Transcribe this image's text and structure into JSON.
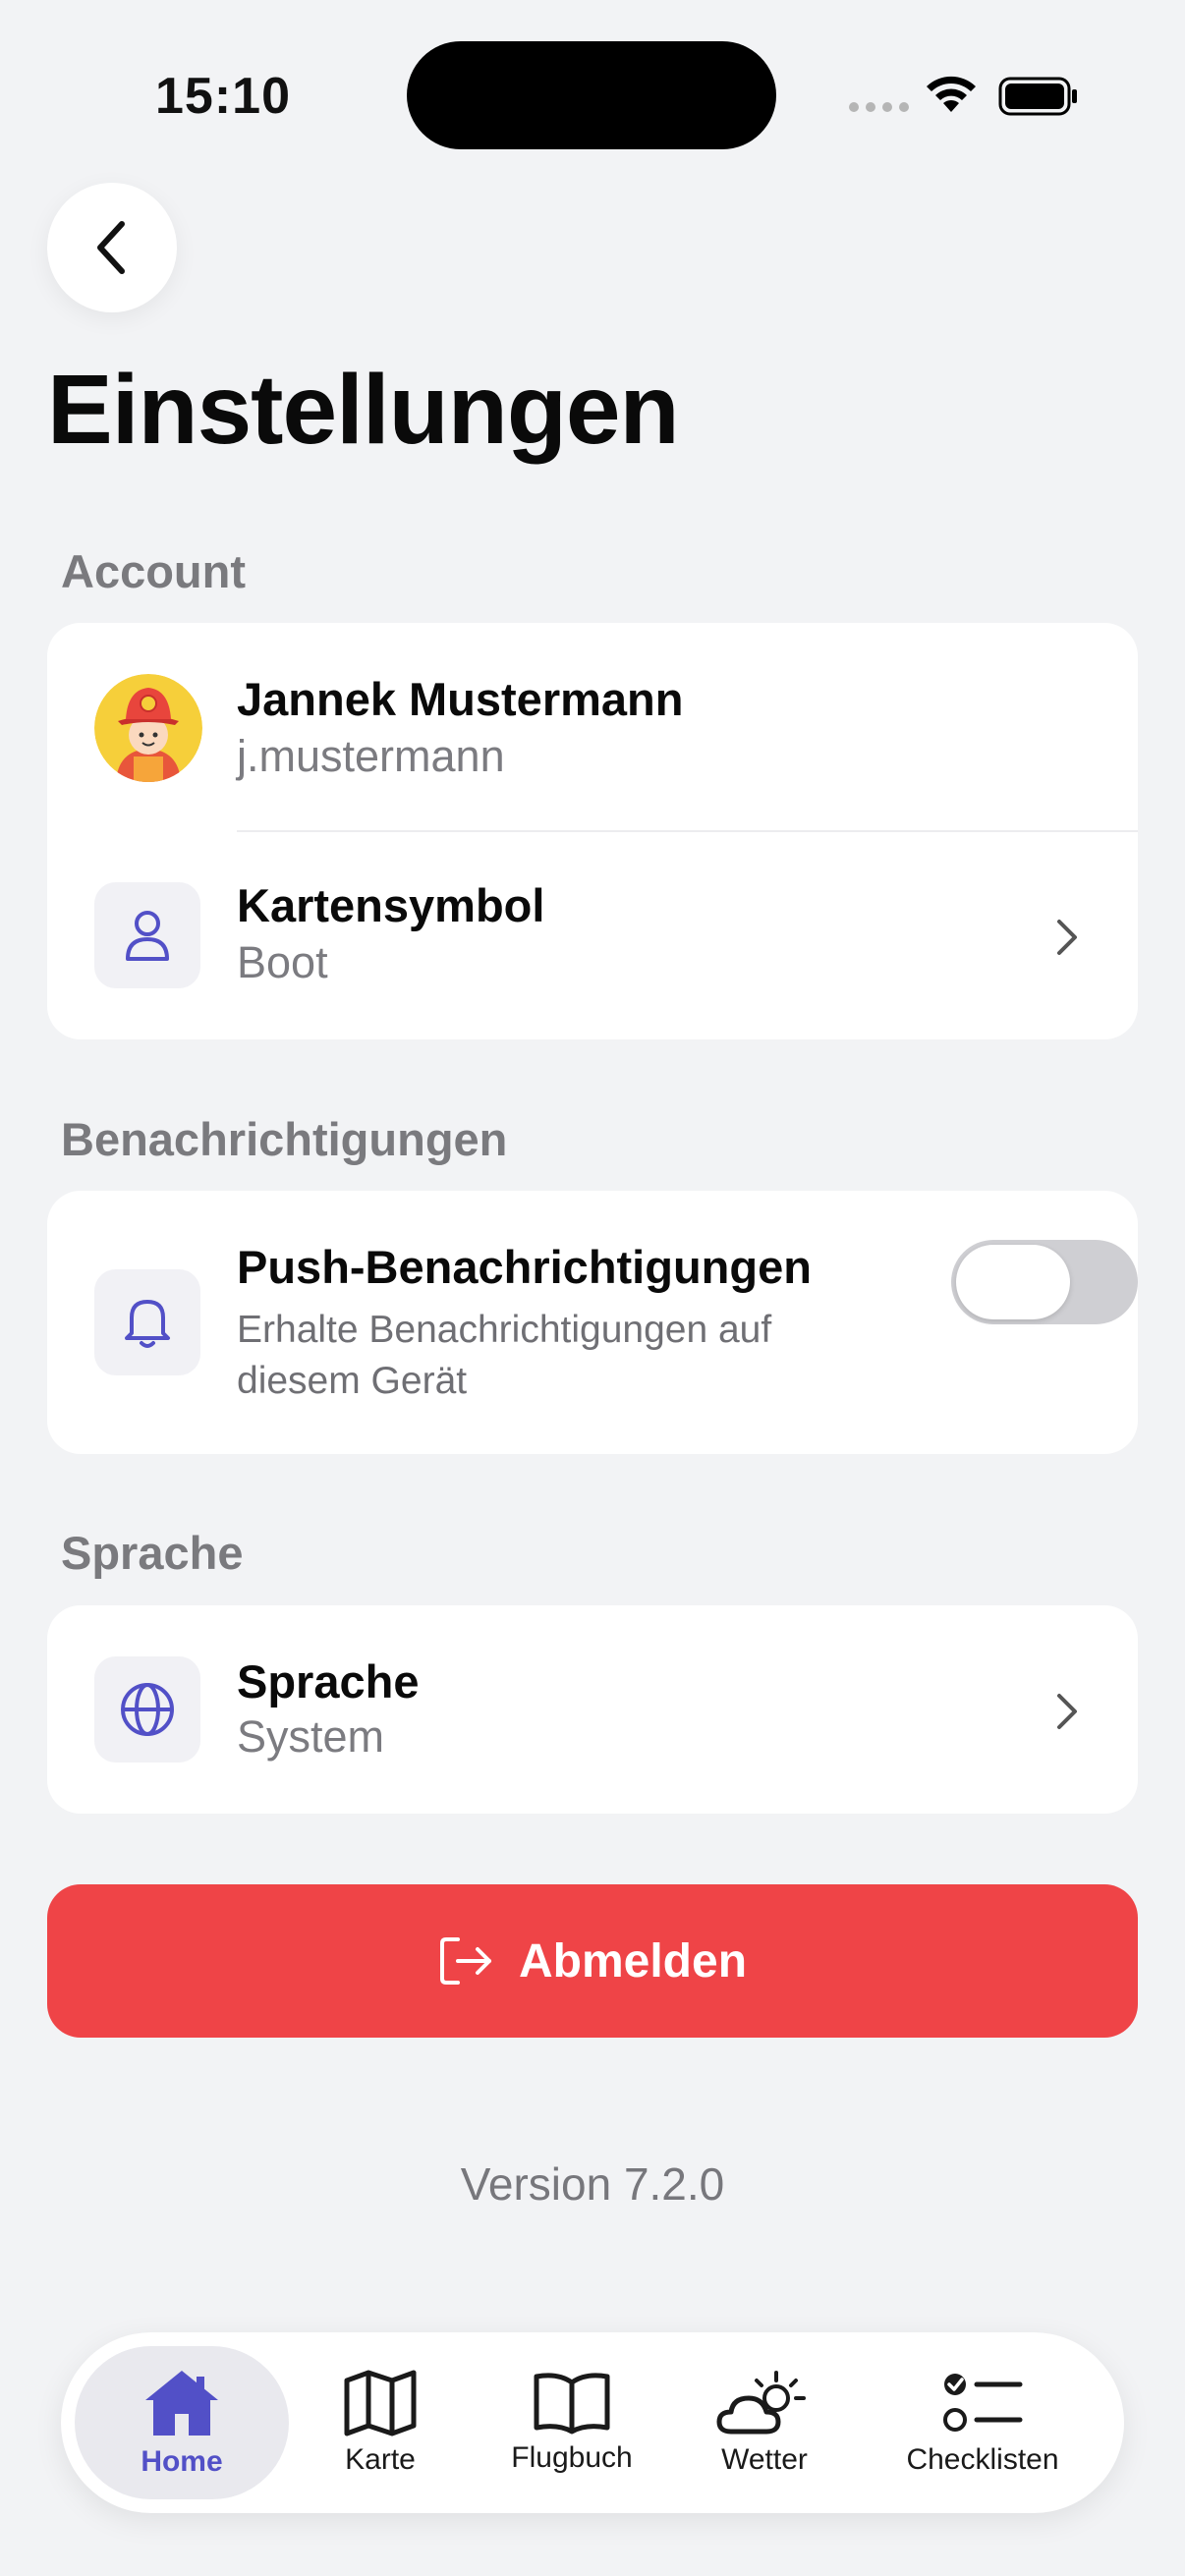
{
  "status_bar": {
    "time": "15:10"
  },
  "header": {
    "title": "Einstellungen"
  },
  "sections": {
    "account": {
      "label": "Account",
      "user": {
        "name": "Jannek Mustermann",
        "username": "j.mustermann"
      },
      "map_symbol": {
        "title": "Kartensymbol",
        "value": "Boot"
      }
    },
    "notifications": {
      "label": "Benachrichtigungen",
      "push": {
        "title": "Push-Benachrichtigungen",
        "description": "Erhalte Benachrichtigungen auf diesem Gerät",
        "enabled": false
      }
    },
    "language": {
      "label": "Sprache",
      "setting": {
        "title": "Sprache",
        "value": "System"
      }
    }
  },
  "logout": {
    "label": "Abmelden"
  },
  "version": "Version 7.2.0",
  "tabbar": {
    "tabs": [
      {
        "label": "Home",
        "icon": "home-icon",
        "active": true
      },
      {
        "label": "Karte",
        "icon": "map-icon",
        "active": false
      },
      {
        "label": "Flugbuch",
        "icon": "book-icon",
        "active": false
      },
      {
        "label": "Wetter",
        "icon": "weather-icon",
        "active": false
      },
      {
        "label": "Checklisten",
        "icon": "checklist-icon",
        "active": false
      }
    ]
  },
  "colors": {
    "accent": "#5250c7",
    "danger": "#ef4447",
    "background": "#f2f3f5"
  }
}
